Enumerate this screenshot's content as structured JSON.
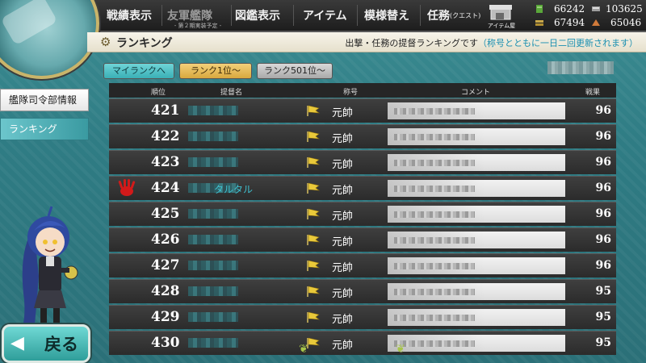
{
  "top_menu": {
    "items": [
      {
        "label": "戦績表示"
      },
      {
        "label": "友軍艦隊",
        "sub": "- 第２期実装予定 -",
        "disabled": true
      },
      {
        "label": "図鑑表示"
      },
      {
        "label": "アイテム"
      },
      {
        "label": "模様替え"
      },
      {
        "label": "任務",
        "suffix": "(クエスト)"
      }
    ],
    "item_shop_label": "アイテム屋"
  },
  "resources": {
    "fuel": "66242",
    "ammo": "67494",
    "steel": "103625",
    "bauxite": "65046"
  },
  "header": {
    "title": "ランキング",
    "note_main": "出撃・任務の提督ランキングです",
    "note_highlight": "（称号とともに一日二回更新されます）"
  },
  "sub_nav": {
    "my_rank": "マイランクへ",
    "rank_1": "ランク1位～",
    "rank_501": "ランク501位～"
  },
  "sidebar": {
    "items": [
      {
        "label": "艦隊司令部情報"
      },
      {
        "label": "ランキング"
      }
    ]
  },
  "table": {
    "headers": {
      "rank": "順位",
      "name": "提督名",
      "title": "称号",
      "comment": "コメント",
      "score": "戦果"
    },
    "rows": [
      {
        "rank": "421",
        "name": "",
        "title": "元帥",
        "score": "96"
      },
      {
        "rank": "422",
        "name": "",
        "title": "元帥",
        "score": "96"
      },
      {
        "rank": "423",
        "name": "",
        "title": "元帥",
        "score": "96"
      },
      {
        "rank": "424",
        "name": "タルタル",
        "title": "元帥",
        "score": "96"
      },
      {
        "rank": "425",
        "name": "",
        "title": "元帥",
        "score": "96"
      },
      {
        "rank": "426",
        "name": "",
        "title": "元帥",
        "score": "96"
      },
      {
        "rank": "427",
        "name": "",
        "title": "元帥",
        "score": "96"
      },
      {
        "rank": "428",
        "name": "",
        "title": "元帥",
        "score": "95"
      },
      {
        "rank": "429",
        "name": "",
        "title": "元帥",
        "score": "95"
      },
      {
        "rank": "430",
        "name": "",
        "title": "元帥",
        "score": "95"
      }
    ]
  },
  "back_button": {
    "label": "戻る"
  },
  "colors": {
    "accent_teal": "#3ab0b6",
    "highlight_name": "#3fc0cf",
    "gold": "#d8a83e"
  }
}
